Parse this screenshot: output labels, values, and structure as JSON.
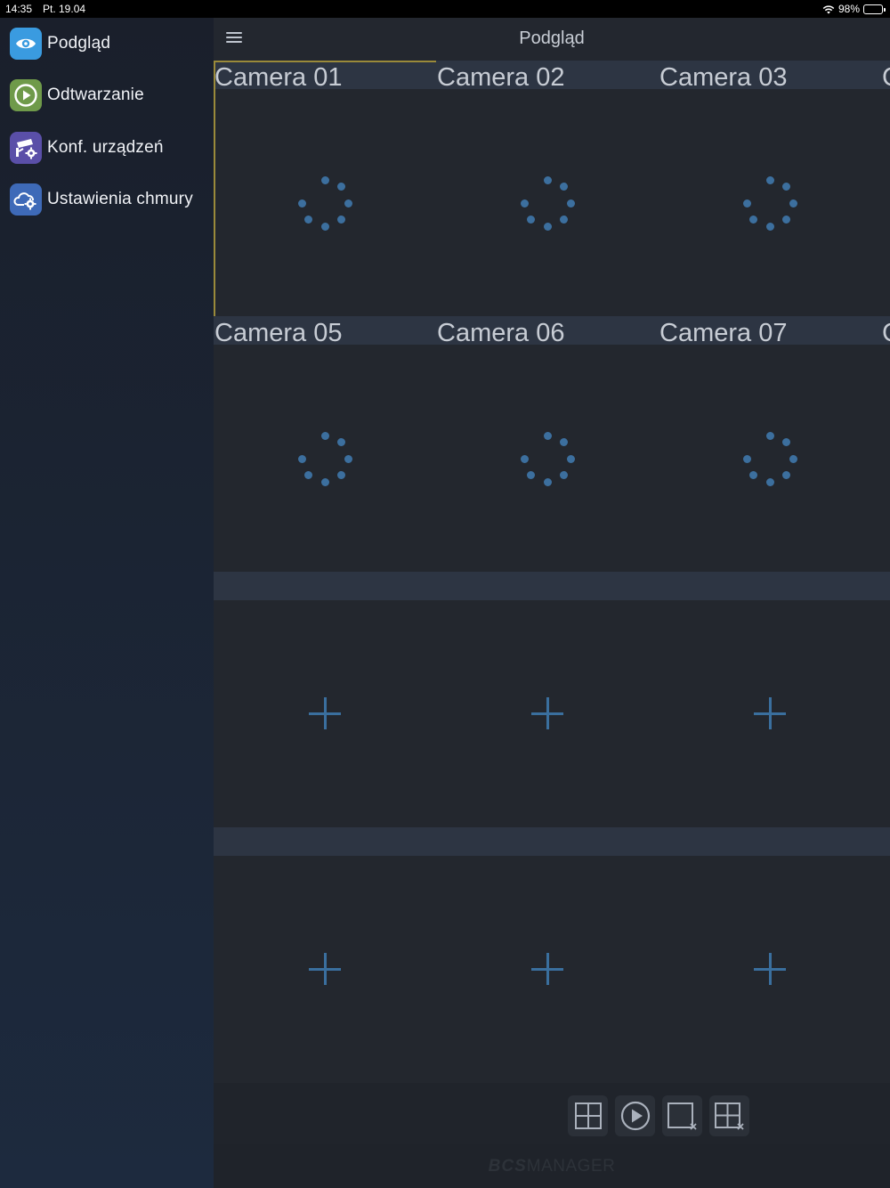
{
  "status_bar": {
    "time": "14:35",
    "date": "Pt. 19.04",
    "battery": "98%"
  },
  "sidebar": {
    "items": [
      {
        "label": "Podgląd",
        "icon": "eye-icon",
        "color": "#3a9be0"
      },
      {
        "label": "Odtwarzanie",
        "icon": "play-circle-icon",
        "color": "#6f9a4a"
      },
      {
        "label": "Konf. urządzeń",
        "icon": "camera-settings-icon",
        "color": "#5a4fa8"
      },
      {
        "label": "Ustawienia chmury",
        "icon": "cloud-settings-icon",
        "color": "#3e6ab8"
      }
    ]
  },
  "header": {
    "title": "Podgląd"
  },
  "grid": {
    "cameras": [
      "Camera 01",
      "Camera 02",
      "Camera 03",
      "Camera 05",
      "Camera 06",
      "Camera 07"
    ],
    "partial_label": "C",
    "selected": "Camera 01",
    "accent": "#3a6f9e"
  },
  "toolbar": [
    "layout-grid-icon",
    "play-circle-icon",
    "close-window-icon",
    "close-grid-icon"
  ],
  "footer": {
    "brand_bold": "BCS",
    "brand_text": "MANAGER"
  }
}
